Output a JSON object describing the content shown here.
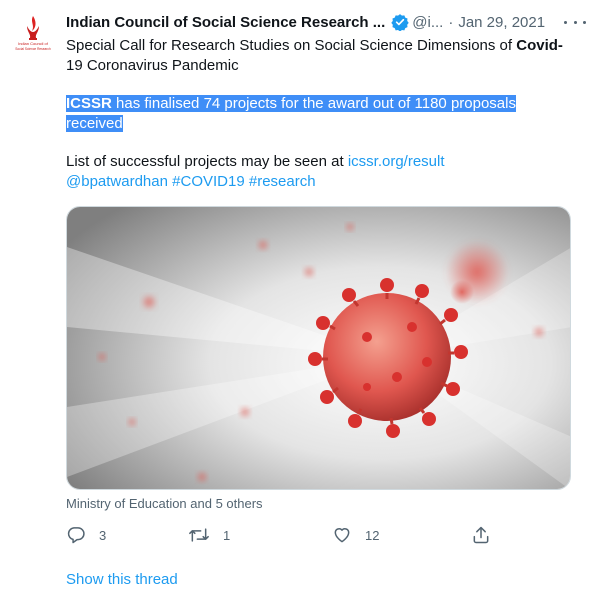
{
  "tweet": {
    "author_name": "Indian Council of Social Science Research ...",
    "handle": "@i...",
    "separator": "·",
    "date": "Jan 29, 2021",
    "logo_text": "Indian Council of Social Science Research",
    "line1_pre": "Special Call for Research Studies on Social Science Dimensions of ",
    "line1_bold": "Covid-",
    "line1_post": "19 Coronavirus Pandemic",
    "highlight_bold": "ICSSR",
    "highlight_rest": " has finalised 74 projects for the award out of 1180 proposals received",
    "list_text": "List of successful projects may be seen at ",
    "list_link": "icssr.org/result",
    "mention": "@bpatwardhan",
    "hashtag1": "#COVID19",
    "hashtag2": "#research",
    "media_alt": "coronavirus illustration",
    "media_caption": "Ministry of Education and 5 others"
  },
  "actions": {
    "reply_count": "3",
    "retweet_count": "1",
    "like_count": "12"
  },
  "footer": {
    "show_thread": "Show this thread"
  },
  "icons": {
    "verified": "verified-badge-icon",
    "more": "more-options-icon",
    "reply": "reply-icon",
    "retweet": "retweet-icon",
    "like": "like-icon",
    "share": "share-icon"
  },
  "colors": {
    "link": "#1d9bf0",
    "highlight": "#3f8ef7",
    "secondary_text": "#536471",
    "virus": "#e0574f"
  }
}
